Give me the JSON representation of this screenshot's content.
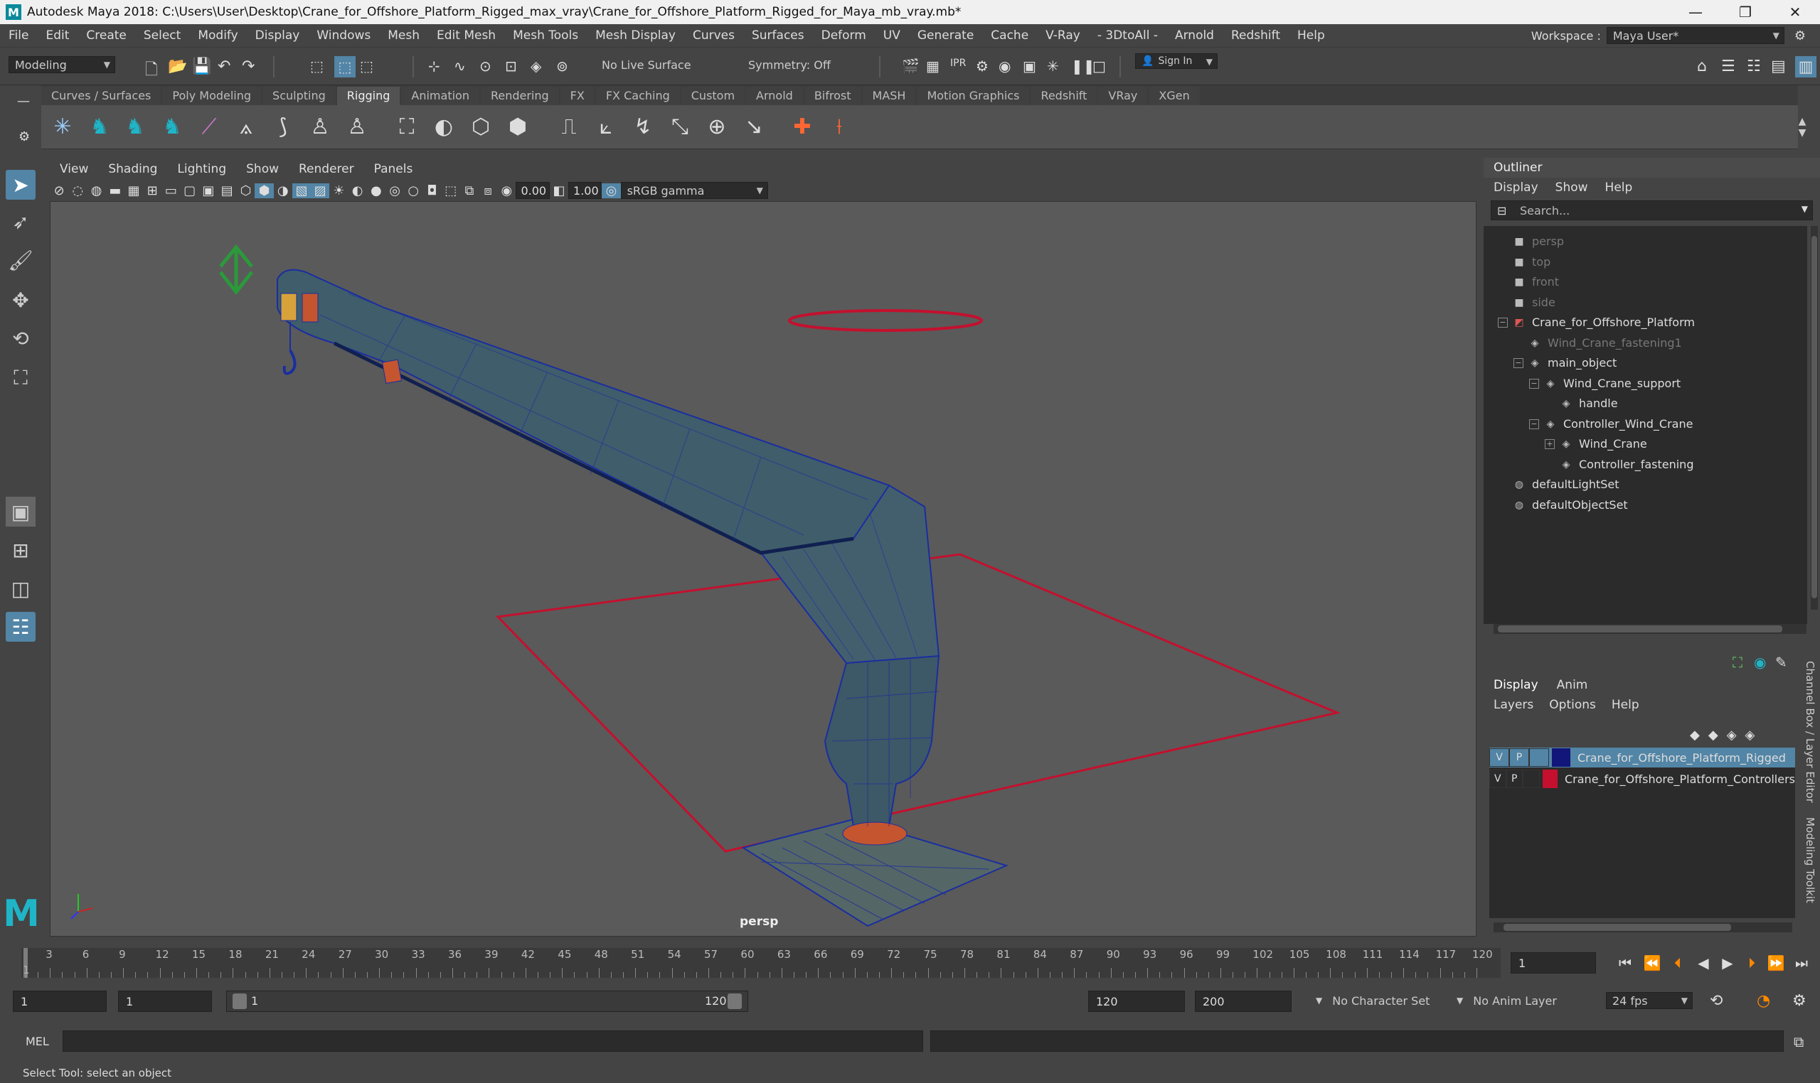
{
  "window": {
    "title": "Autodesk Maya 2018: C:\\Users\\User\\Desktop\\Crane_for_Offshore_Platform_Rigged_max_vray\\Crane_for_Offshore_Platform_Rigged_for_Maya_mb_vray.mb*"
  },
  "menubar": {
    "items": [
      "File",
      "Edit",
      "Create",
      "Select",
      "Modify",
      "Display",
      "Windows",
      "Mesh",
      "Edit Mesh",
      "Mesh Tools",
      "Mesh Display",
      "Curves",
      "Surfaces",
      "Deform",
      "UV",
      "Generate",
      "Cache",
      "V-Ray",
      "- 3DtoAll -",
      "Arnold",
      "Redshift",
      "Help"
    ],
    "workspace_label": "Workspace :",
    "workspace_value": "Maya User*"
  },
  "statusline": {
    "mode": "Modeling",
    "live_surface": "No Live Surface",
    "symmetry": "Symmetry: Off",
    "sign_in": "Sign In"
  },
  "shelf": {
    "tabs": [
      "Curves / Surfaces",
      "Poly Modeling",
      "Sculpting",
      "Rigging",
      "Animation",
      "Rendering",
      "FX",
      "FX Caching",
      "Custom",
      "Arnold",
      "Bifrost",
      "MASH",
      "Motion Graphics",
      "Redshift",
      "VRay",
      "XGen"
    ],
    "active_tab": "Rigging"
  },
  "viewport": {
    "menu": [
      "View",
      "Shading",
      "Lighting",
      "Show",
      "Renderer",
      "Panels"
    ],
    "exposure": "0.00",
    "gamma": "1.00",
    "color_space": "sRGB gamma",
    "camera_label": "persp"
  },
  "outliner": {
    "title": "Outliner",
    "menu": [
      "Display",
      "Show",
      "Help"
    ],
    "search_placeholder": "Search...",
    "items": [
      {
        "label": "persp",
        "depth": 0,
        "icon": "camera-icon",
        "dim": true
      },
      {
        "label": "top",
        "depth": 0,
        "icon": "camera-icon",
        "dim": true
      },
      {
        "label": "front",
        "depth": 0,
        "icon": "camera-icon",
        "dim": true
      },
      {
        "label": "side",
        "depth": 0,
        "icon": "camera-icon",
        "dim": true
      },
      {
        "label": "Crane_for_Offshore_Platform",
        "depth": 0,
        "icon": "transform-icon",
        "dim": false,
        "expand": "−"
      },
      {
        "label": "Wind_Crane_fastening1",
        "depth": 1,
        "icon": "mesh-icon",
        "dim": true
      },
      {
        "label": "main_object",
        "depth": 1,
        "icon": "mesh-icon",
        "dim": false,
        "expand": "−"
      },
      {
        "label": "Wind_Crane_support",
        "depth": 2,
        "icon": "mesh-icon",
        "dim": false,
        "expand": "−"
      },
      {
        "label": "handle",
        "depth": 3,
        "icon": "mesh-icon",
        "dim": false
      },
      {
        "label": "Controller_Wind_Crane",
        "depth": 2,
        "icon": "mesh-icon",
        "dim": false,
        "expand": "−"
      },
      {
        "label": "Wind_Crane",
        "depth": 3,
        "icon": "mesh-icon",
        "dim": false,
        "expand": "+"
      },
      {
        "label": "Controller_fastening",
        "depth": 3,
        "icon": "mesh-icon",
        "dim": false
      },
      {
        "label": "defaultLightSet",
        "depth": 0,
        "icon": "set-icon",
        "dim": false
      },
      {
        "label": "defaultObjectSet",
        "depth": 0,
        "icon": "set-icon",
        "dim": false
      }
    ]
  },
  "layer_editor": {
    "tabs": [
      "Display",
      "Anim"
    ],
    "menu": [
      "Layers",
      "Options",
      "Help"
    ],
    "layers": [
      {
        "v": "V",
        "p": "P",
        "color": "#12157a",
        "name": "Crane_for_Offshore_Platform_Rigged",
        "selected": true
      },
      {
        "v": "V",
        "p": "P",
        "color": "#c4102e",
        "name": "Crane_for_Offshore_Platform_Controllers",
        "selected": false
      }
    ],
    "side_tabs": [
      "Channel Box / Layer Editor",
      "Modeling Toolkit"
    ]
  },
  "timeline": {
    "ticks": [
      "3",
      "6",
      "9",
      "12",
      "15",
      "18",
      "21",
      "24",
      "27",
      "30",
      "33",
      "36",
      "39",
      "42",
      "45",
      "48",
      "51",
      "54",
      "57",
      "60",
      "63",
      "66",
      "69",
      "72",
      "75",
      "78",
      "81",
      "84",
      "87",
      "90",
      "93",
      "96",
      "99",
      "102",
      "105",
      "108",
      "111",
      "114",
      "117",
      "120"
    ],
    "start_mark": "1",
    "current_frame": "1"
  },
  "range": {
    "start": "1",
    "playback_start": "1",
    "slider_start": "1",
    "slider_end": "120",
    "playback_end": "120",
    "end": "200",
    "character_set": "No Character Set",
    "anim_layer": "No Anim Layer",
    "fps": "24 fps"
  },
  "cmdline": {
    "label": "MEL"
  },
  "helpline": {
    "text": "Select Tool: select an object"
  },
  "colors": {
    "accent": "#5285a6",
    "selection": "#5285a6",
    "wire": "#1a2ea0",
    "controller": "#c4102e"
  }
}
